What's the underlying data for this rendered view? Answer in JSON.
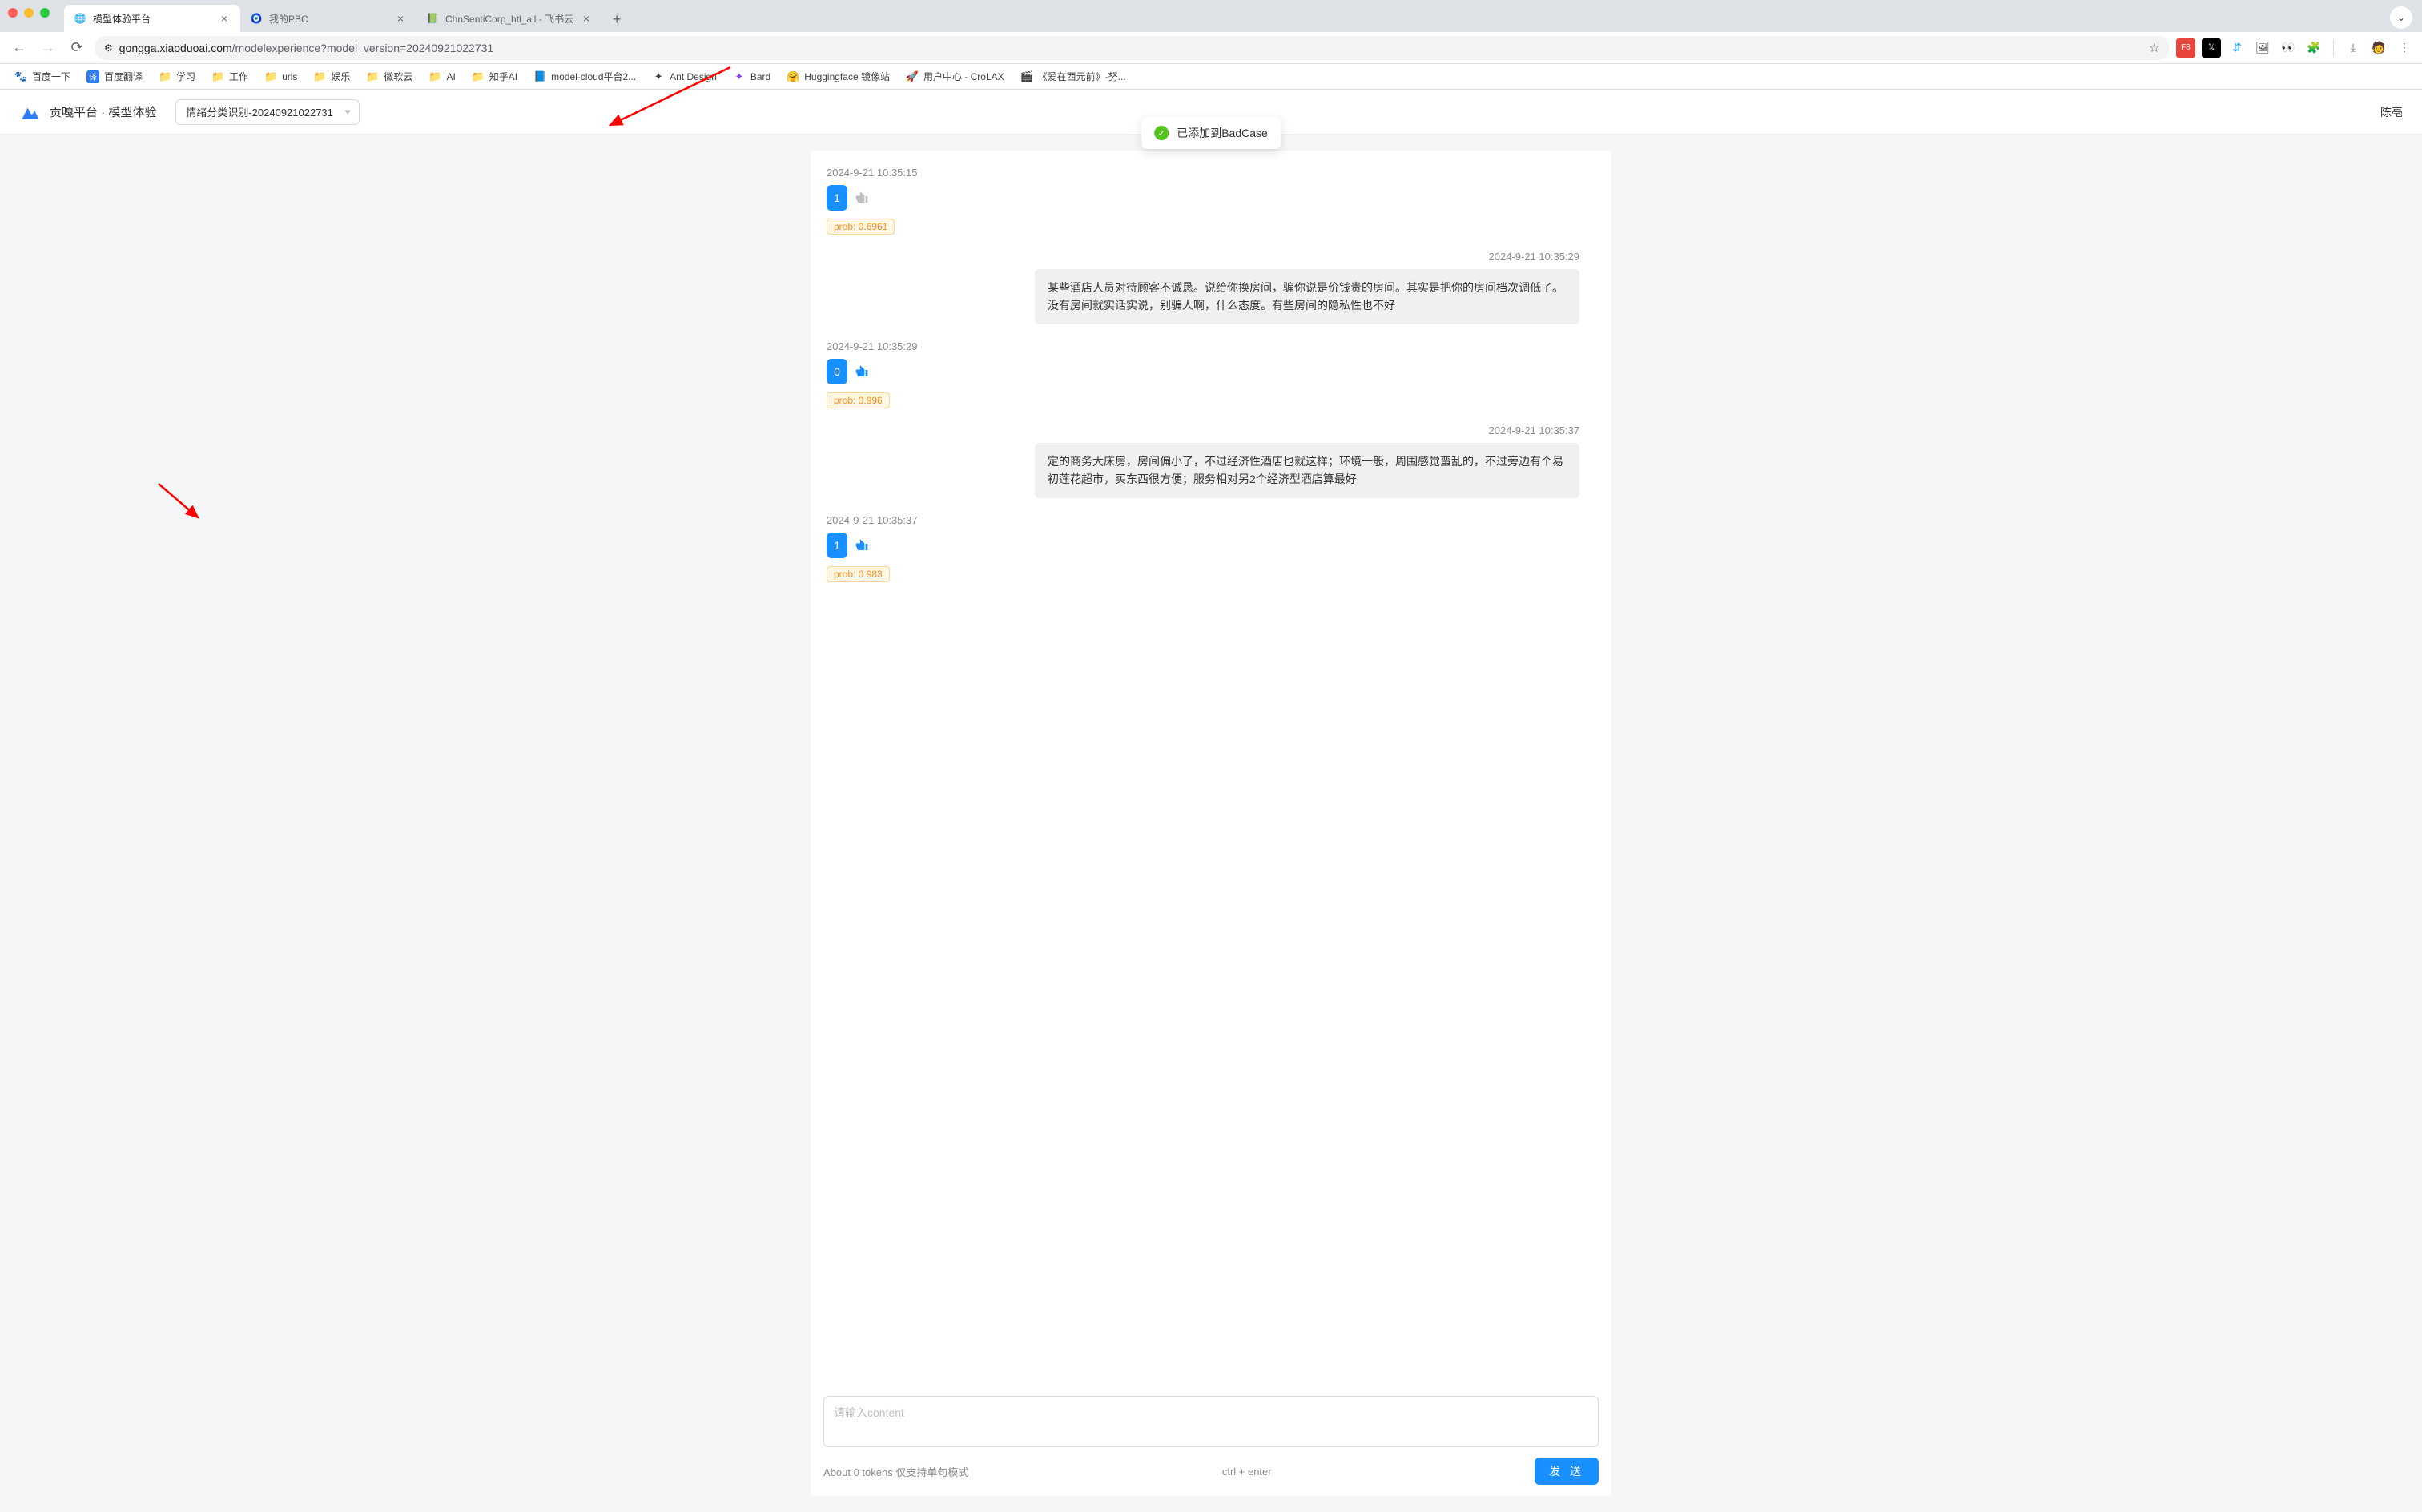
{
  "window": {
    "tabs": [
      {
        "title": "模型体验平台",
        "favicon": "🌐",
        "active": true
      },
      {
        "title": "我的PBC",
        "favicon": "🧿"
      },
      {
        "title": "ChnSentiCorp_htl_all - 飞书云",
        "favicon": "📗"
      }
    ]
  },
  "addr": {
    "site_icon": "⚙",
    "host": "gongga.xiaoduoai.com",
    "path": "/modelexperience?model_version=20240921022731"
  },
  "bookmarks": [
    {
      "icon": "🐾",
      "label": "百度一下"
    },
    {
      "icon": "译",
      "label": "百度翻译",
      "iconBg": "#2b7de9",
      "iconColor": "#fff"
    },
    {
      "icon": "📁",
      "label": "学习"
    },
    {
      "icon": "📁",
      "label": "工作"
    },
    {
      "icon": "📁",
      "label": "urls"
    },
    {
      "icon": "📁",
      "label": "娱乐"
    },
    {
      "icon": "📁",
      "label": "微软云"
    },
    {
      "icon": "📁",
      "label": "AI"
    },
    {
      "icon": "📁",
      "label": "知乎AI"
    },
    {
      "icon": "📘",
      "label": "model-cloud平台2..."
    },
    {
      "icon": "✦",
      "label": "Ant Design"
    },
    {
      "icon": "✦",
      "label": "Bard",
      "iconColor": "#8e44ec"
    },
    {
      "icon": "🤗",
      "label": "Huggingface 镜像站"
    },
    {
      "icon": "🚀",
      "label": "用户中心 - CroLAX"
    },
    {
      "icon": "🎬",
      "label": "《爱在西元前》-努..."
    }
  ],
  "app": {
    "title": "贡嘎平台 · 模型体验",
    "model": "情绪分类识别-20240921022731",
    "user": "陈亳"
  },
  "toast": {
    "text": "已添加到BadCase"
  },
  "chat": [
    {
      "type": "result",
      "time": "2024-9-21 10:35:15",
      "value": "1",
      "prob": "prob: 0.6961",
      "disliked": false
    },
    {
      "type": "user",
      "time": "2024-9-21 10:35:29",
      "text": "某些酒店人员对待顾客不诚恳。说给你换房间，骗你说是价钱贵的房间。其实是把你的房间档次调低了。没有房间就实话实说，别骗人啊，什么态度。有些房间的隐私性也不好"
    },
    {
      "type": "result",
      "time": "2024-9-21 10:35:29",
      "value": "0",
      "prob": "prob: 0.996",
      "disliked": true
    },
    {
      "type": "user",
      "time": "2024-9-21 10:35:37",
      "text": "定的商务大床房，房间偏小了，不过经济性酒店也就这样；环境一般，周围感觉蛮乱的，不过旁边有个易初莲花超市，买东西很方便；服务相对另2个经济型酒店算最好"
    },
    {
      "type": "result",
      "time": "2024-9-21 10:35:37",
      "value": "1",
      "prob": "prob: 0.983",
      "disliked": true
    }
  ],
  "input": {
    "placeholder": "请输入content",
    "token_hint": "About 0 tokens 仅支持单句模式",
    "shortcut": "ctrl + enter",
    "send": "发 送"
  },
  "colors": {
    "primary": "#1890ff",
    "warning_border": "#ffd591",
    "warning_bg": "#fff7e6",
    "warning_text": "#fa8c16",
    "success": "#52c41a",
    "arrow": "#ff0000"
  }
}
